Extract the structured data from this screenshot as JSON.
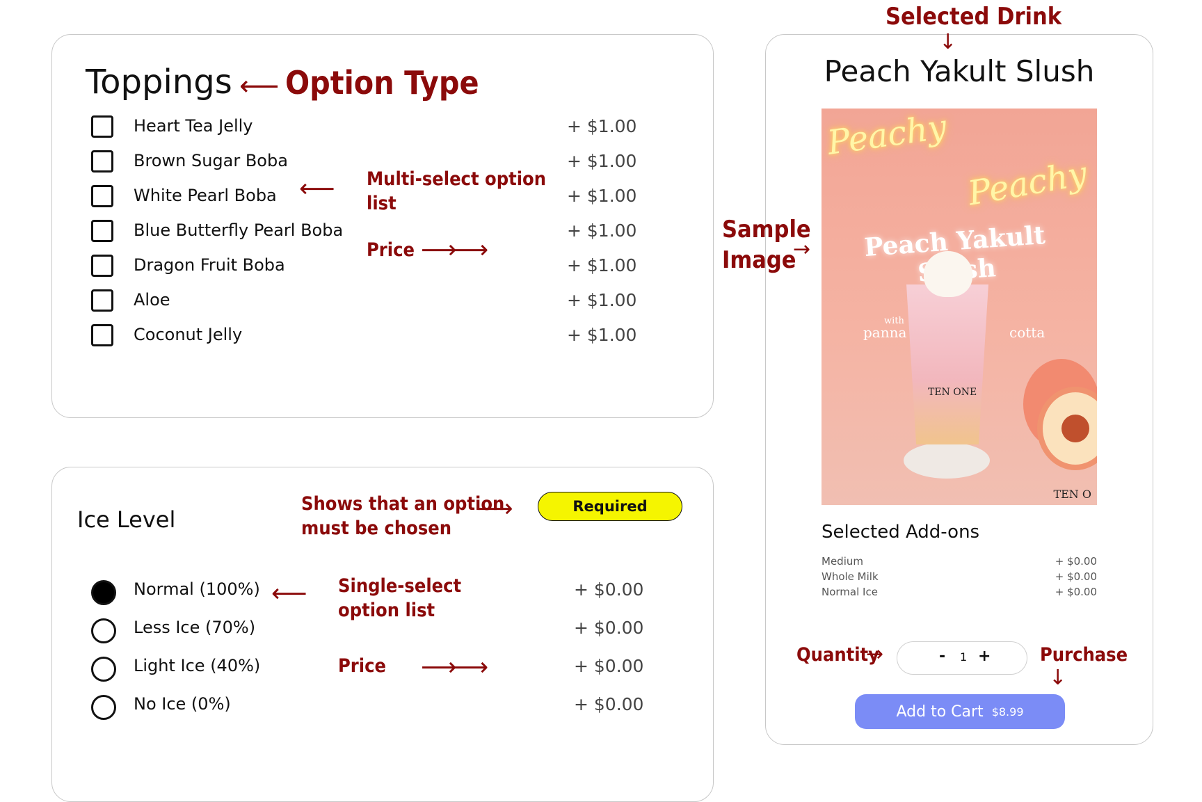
{
  "colors": {
    "accent": "#7b8cf6",
    "required_badge": "#f5f500",
    "annotation": "#8b0a0a"
  },
  "toppings": {
    "title": "Toppings",
    "options": [
      {
        "label": "Heart Tea Jelly",
        "price": "+ $1.00"
      },
      {
        "label": "Brown Sugar Boba",
        "price": "+ $1.00"
      },
      {
        "label": "White Pearl Boba",
        "price": "+ $1.00"
      },
      {
        "label": "Blue Butterfly Pearl Boba",
        "price": "+ $1.00"
      },
      {
        "label": "Dragon Fruit Boba",
        "price": "+ $1.00"
      },
      {
        "label": "Aloe",
        "price": "+ $1.00"
      },
      {
        "label": "Coconut Jelly",
        "price": "+ $1.00"
      }
    ]
  },
  "ice": {
    "title": "Ice Level",
    "badge": "Required",
    "options": [
      {
        "label": "Normal (100%)",
        "price": "+ $0.00",
        "selected": true
      },
      {
        "label": "Less Ice (70%)",
        "price": "+ $0.00",
        "selected": false
      },
      {
        "label": "Light Ice (40%)",
        "price": "+ $0.00",
        "selected": false
      },
      {
        "label": "No Ice (0%)",
        "price": "+ $0.00",
        "selected": false
      }
    ]
  },
  "drink": {
    "title": "Peach Yakult Slush",
    "image": {
      "neon_1": "Peachy",
      "neon_2": "Peachy",
      "poster_title": "Peach Yakult Slush",
      "with": "with",
      "panna": "panna",
      "cotta": "cotta",
      "cup_brand": "TEN ONE",
      "corner_brand": "TEN O"
    },
    "addons_title": "Selected Add-ons",
    "addons": [
      {
        "label": "Medium",
        "price": "+ $0.00"
      },
      {
        "label": "Whole Milk",
        "price": "+ $0.00"
      },
      {
        "label": "Normal Ice",
        "price": "+ $0.00"
      }
    ],
    "quantity": {
      "minus": "-",
      "value": "1",
      "plus": "+"
    },
    "add_to_cart": {
      "label": "Add to Cart",
      "price": "$8.99"
    }
  },
  "annotations": {
    "selected_drink": "Selected Drink",
    "option_type": "Option Type",
    "multi_select_1": "Multi-select option",
    "multi_select_2": "list",
    "price_1": "Price",
    "sample_image_1": "Sample",
    "sample_image_2": "Image",
    "required_1": "Shows that an option",
    "required_2": "must be chosen",
    "single_select_1": "Single-select",
    "single_select_2": "option list",
    "price_2": "Price",
    "quantity": "Quantity",
    "purchase": "Purchase"
  }
}
